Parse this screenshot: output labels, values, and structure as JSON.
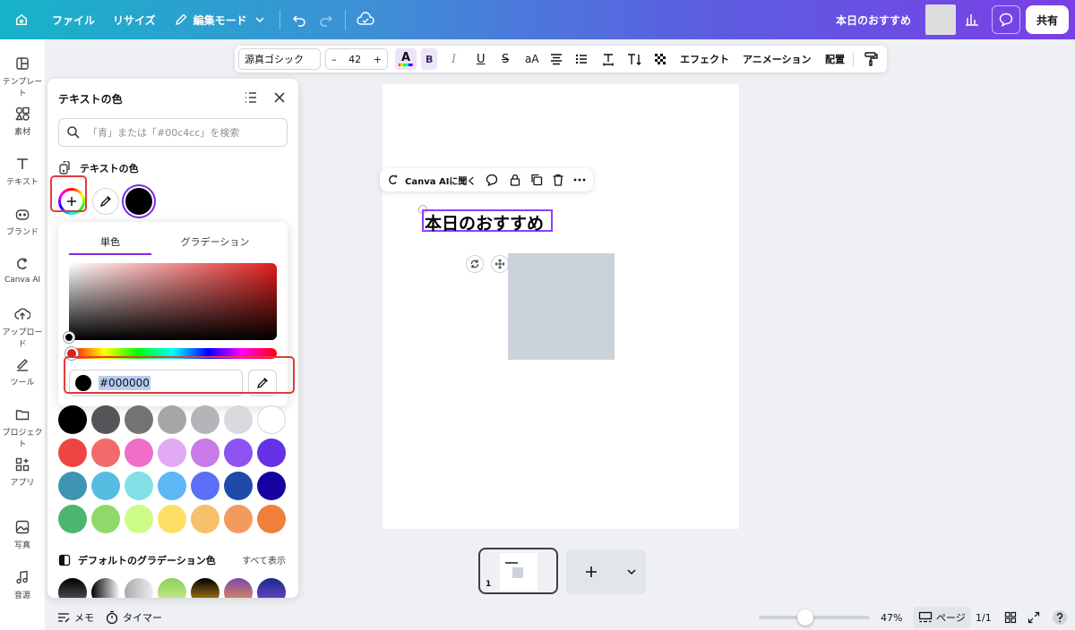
{
  "topbar": {
    "file": "ファイル",
    "resize": "リサイズ",
    "edit_mode": "編集モード",
    "doc_title": "本日のおすすめ",
    "share": "共有"
  },
  "rail": [
    {
      "label": "テンプレート",
      "icon": "template-icon"
    },
    {
      "label": "素材",
      "icon": "elements-icon"
    },
    {
      "label": "テキスト",
      "icon": "text-icon"
    },
    {
      "label": "ブランド",
      "icon": "brand-icon"
    },
    {
      "label": "Canva AI",
      "icon": "canva-ai-icon"
    },
    {
      "label": "アップロード",
      "icon": "upload-icon"
    },
    {
      "label": "ツール",
      "icon": "tools-icon"
    },
    {
      "label": "プロジェクト",
      "icon": "folder-icon"
    },
    {
      "label": "アプリ",
      "icon": "apps-icon"
    },
    {
      "label": "写真",
      "icon": "photo-icon"
    },
    {
      "label": "音源",
      "icon": "music-icon"
    }
  ],
  "panel": {
    "title": "テキストの色",
    "search_placeholder": "「青」または「#00c4cc」を検索",
    "section_text_color": "テキストの色",
    "tabs": [
      "単色",
      "グラデーション"
    ],
    "hex_value": "#000000",
    "gradient_section": "デフォルトのグラデーション色",
    "show_all": "すべて表示"
  },
  "palette": [
    [
      "#000000",
      "#545459",
      "#737373",
      "#a6a6a6",
      "#b4b4b9",
      "#d9d9de",
      "#ffffff"
    ],
    [
      "#ee4444",
      "#f26a6a",
      "#f06ec6",
      "#e2aaf2",
      "#c87ae6",
      "#8d52f2",
      "#6431e6"
    ],
    [
      "#3f94b4",
      "#57bce2",
      "#82e0e6",
      "#5db7f5",
      "#5a6ff5",
      "#1e4aa8",
      "#1600a0"
    ],
    [
      "#4cb66e",
      "#8fd96a",
      "#cdfc88",
      "#ffde66",
      "#f6c06a",
      "#f29b5e",
      "#f07f3a"
    ]
  ],
  "toolbar": {
    "font": "源真ゴシック",
    "size": "42",
    "effects": "エフェクト",
    "animation": "アニメーション",
    "position": "配置"
  },
  "canvas": {
    "ai_prompt": "Canva AIに聞く",
    "headline": "本日のおすすめ",
    "page_number": "1"
  },
  "bottom": {
    "notes": "メモ",
    "timer": "タイマー",
    "zoom": "47%",
    "pages_label": "ページ",
    "page_count": "1/1"
  }
}
